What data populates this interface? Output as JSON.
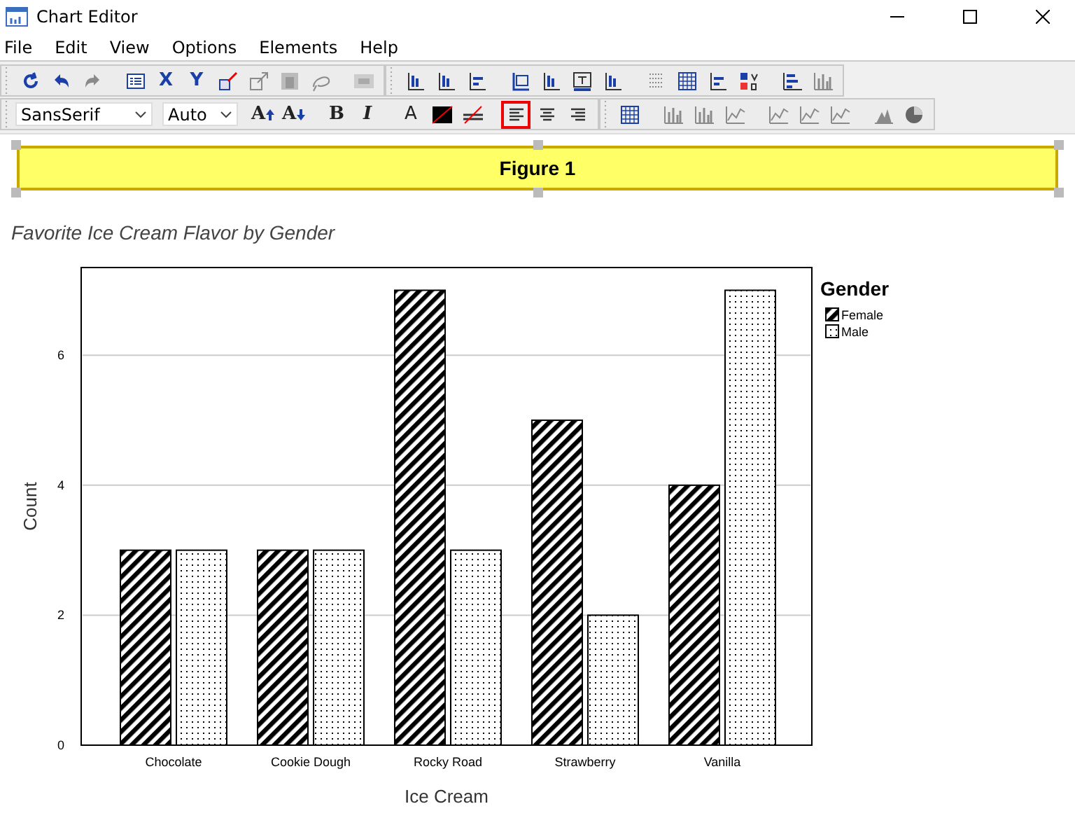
{
  "window": {
    "title": "Chart Editor"
  },
  "menu": [
    {
      "label": "File"
    },
    {
      "label": "Edit"
    },
    {
      "label": "View"
    },
    {
      "label": "Options"
    },
    {
      "label": "Elements"
    },
    {
      "label": "Help"
    }
  ],
  "toolbar": {
    "axis_buttons": [
      {
        "label": "X"
      },
      {
        "label": "Y"
      }
    ],
    "font": "SansSerif",
    "size": "Auto",
    "grow": "A",
    "shrink": "A",
    "bold": "B",
    "italic": "I",
    "text_color": "A",
    "align": [
      {
        "selected": true
      },
      {
        "selected": false
      },
      {
        "selected": false
      }
    ]
  },
  "banner": {
    "label": "Figure 1",
    "selected": true
  },
  "chart": {
    "title": "Favorite Ice Cream Flavor by Gender",
    "chart_data": {
      "type": "bar",
      "xlabel": "Ice Cream",
      "ylabel": "Count",
      "categories": [
        "Chocolate",
        "Cookie Dough",
        "Rocky Road",
        "Strawberry",
        "Vanilla"
      ],
      "series": [
        {
          "name": "Female",
          "values": [
            3,
            3,
            7,
            5,
            4
          ]
        },
        {
          "name": "Male",
          "values": [
            3,
            3,
            3,
            2,
            7
          ]
        }
      ],
      "ylim": [
        0,
        7.35
      ],
      "yticks": [
        0,
        2,
        4,
        6
      ],
      "grid": true,
      "legend": true
    },
    "legend_title": "Gender"
  }
}
